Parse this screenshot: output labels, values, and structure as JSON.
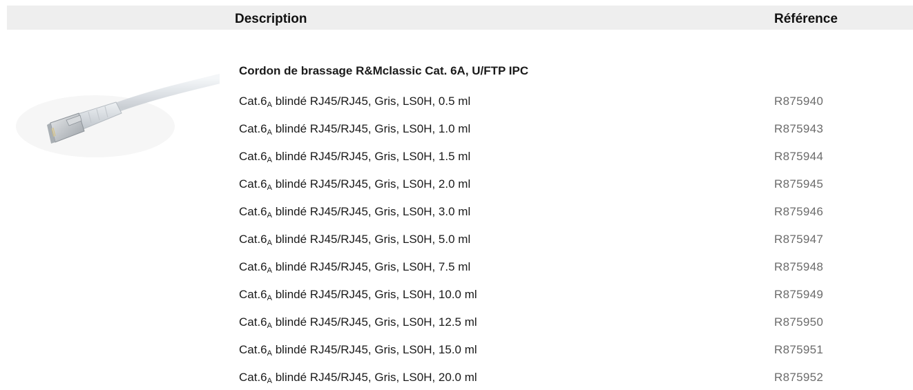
{
  "header": {
    "description_label": "Description",
    "reference_label": "Référence"
  },
  "product": {
    "image_icon": "patch-cord-image",
    "group_title": "Cordon de brassage R&Mclassic Cat. 6A, U/FTP IPC"
  },
  "rows": [
    {
      "prefix": "Cat.6",
      "sub": "A",
      "desc": " blindé RJ45/RJ45, Gris, LS0H, 0.5 ml",
      "ref": "R875940"
    },
    {
      "prefix": "Cat.6",
      "sub": "A",
      "desc": " blindé RJ45/RJ45, Gris, LS0H, 1.0 ml",
      "ref": "R875943"
    },
    {
      "prefix": "Cat.6",
      "sub": "A",
      "desc": " blindé RJ45/RJ45, Gris, LS0H, 1.5 ml",
      "ref": "R875944"
    },
    {
      "prefix": "Cat.6",
      "sub": "A",
      "desc": " blindé RJ45/RJ45, Gris, LS0H, 2.0 ml",
      "ref": "R875945"
    },
    {
      "prefix": "Cat.6",
      "sub": "A",
      "desc": " blindé RJ45/RJ45, Gris, LS0H, 3.0 ml",
      "ref": "R875946"
    },
    {
      "prefix": "Cat.6",
      "sub": "A",
      "desc": " blindé RJ45/RJ45, Gris, LS0H, 5.0 ml",
      "ref": "R875947"
    },
    {
      "prefix": "Cat.6",
      "sub": "A",
      "desc": " blindé RJ45/RJ45, Gris, LS0H, 7.5 ml",
      "ref": "R875948"
    },
    {
      "prefix": "Cat.6",
      "sub": "A",
      "desc": " blindé RJ45/RJ45, Gris, LS0H, 10.0 ml",
      "ref": "R875949"
    },
    {
      "prefix": "Cat.6",
      "sub": "A",
      "desc": " blindé RJ45/RJ45, Gris, LS0H, 12.5 ml",
      "ref": "R875950"
    },
    {
      "prefix": "Cat.6",
      "sub": "A",
      "desc": " blindé RJ45/RJ45, Gris, LS0H, 15.0 ml",
      "ref": "R875951"
    },
    {
      "prefix": "Cat.6",
      "sub": "A",
      "desc": " blindé RJ45/RJ45, Gris, LS0H, 20.0 ml",
      "ref": "R875952"
    }
  ],
  "colors": {
    "header_bg": "#eeeeee",
    "text": "#1a1a1a",
    "ref_text": "#6b6b6b"
  }
}
